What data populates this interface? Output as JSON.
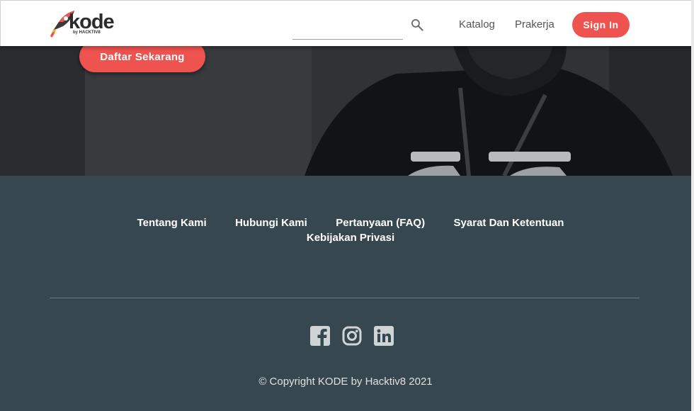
{
  "header": {
    "logo_text": "kode",
    "logo_sub": "by HACKTIV8",
    "search": {
      "value": "",
      "placeholder": ""
    },
    "nav": [
      {
        "label": "Katalog"
      },
      {
        "label": "Prakerja"
      }
    ],
    "signin_label": "Sign In"
  },
  "hero": {
    "cta_label": "Daftar Sekarang"
  },
  "footer": {
    "links": [
      "Tentang Kami",
      "Hubungi Kami",
      "Pertanyaan (FAQ)",
      "Syarat Dan Ketentuan",
      "Kebijakan Privasi"
    ],
    "social_icons": [
      "facebook-icon",
      "instagram-icon",
      "linkedin-icon"
    ],
    "copyright": "© Copyright KODE by Hacktiv8 2021"
  },
  "colors": {
    "accent": "#ef5350",
    "footer_bg": "#37474f",
    "header_bg": "#ffffff"
  }
}
